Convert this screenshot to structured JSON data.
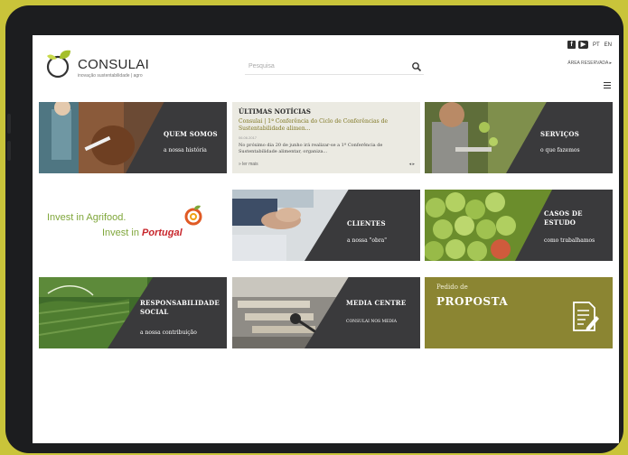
{
  "brand": {
    "name": "CONSULAI",
    "tagline": "inovação sustentabilidade | agro"
  },
  "search": {
    "placeholder": "Pesquisa"
  },
  "header": {
    "lang_pt": "PT",
    "lang_en": "EN",
    "client_area": "ÁREA RESERVADA"
  },
  "tiles": {
    "quem_somos": {
      "title": "QUEM SOMOS",
      "sub": "a nossa história"
    },
    "news": {
      "heading": "ÚLTIMAS NOTÍCIAS",
      "title": "Consulai | 1ª Conferência do Ciclo de Conferências de Sustentabilidade alimen...",
      "date": "06.06.2017",
      "body": "No próximo dia 20 de junho irá realizar-se a 1ª Conferência de Sustentabilidade alimentar, organiza...",
      "more": "ler mais"
    },
    "servicos": {
      "title": "SERVIÇOS",
      "sub": "o que fazemos"
    },
    "agrifood": {
      "line1": "Invest in Agrifood.",
      "line2_a": "Invest in",
      "line2_b": "Portugal"
    },
    "clientes": {
      "title": "CLIENTES",
      "sub": "a nossa \"obra\""
    },
    "casos": {
      "title_1": "CASOS DE",
      "title_2": "ESTUDO",
      "sub": "como trabalhamos"
    },
    "responsabilidade": {
      "title_1": "RESPONSABILIDADE",
      "title_2": "SOCIAL",
      "sub": "a nossa contribuição"
    },
    "media": {
      "title": "MEDIA CENTRE",
      "sub": "CONSULAI NOS MEDIA"
    },
    "proposta": {
      "small": "Pedido de",
      "big": "PROPOSTA"
    }
  },
  "icons": [
    "facebook-icon",
    "youtube-icon",
    "search-icon",
    "menu-icon",
    "document-edit-icon",
    "consulai-logo-icon"
  ],
  "colors": {
    "background": "#c9c43a",
    "accent": "#8b8532",
    "dark_panel": "#3a3a3c",
    "news_title": "#7e7520"
  }
}
